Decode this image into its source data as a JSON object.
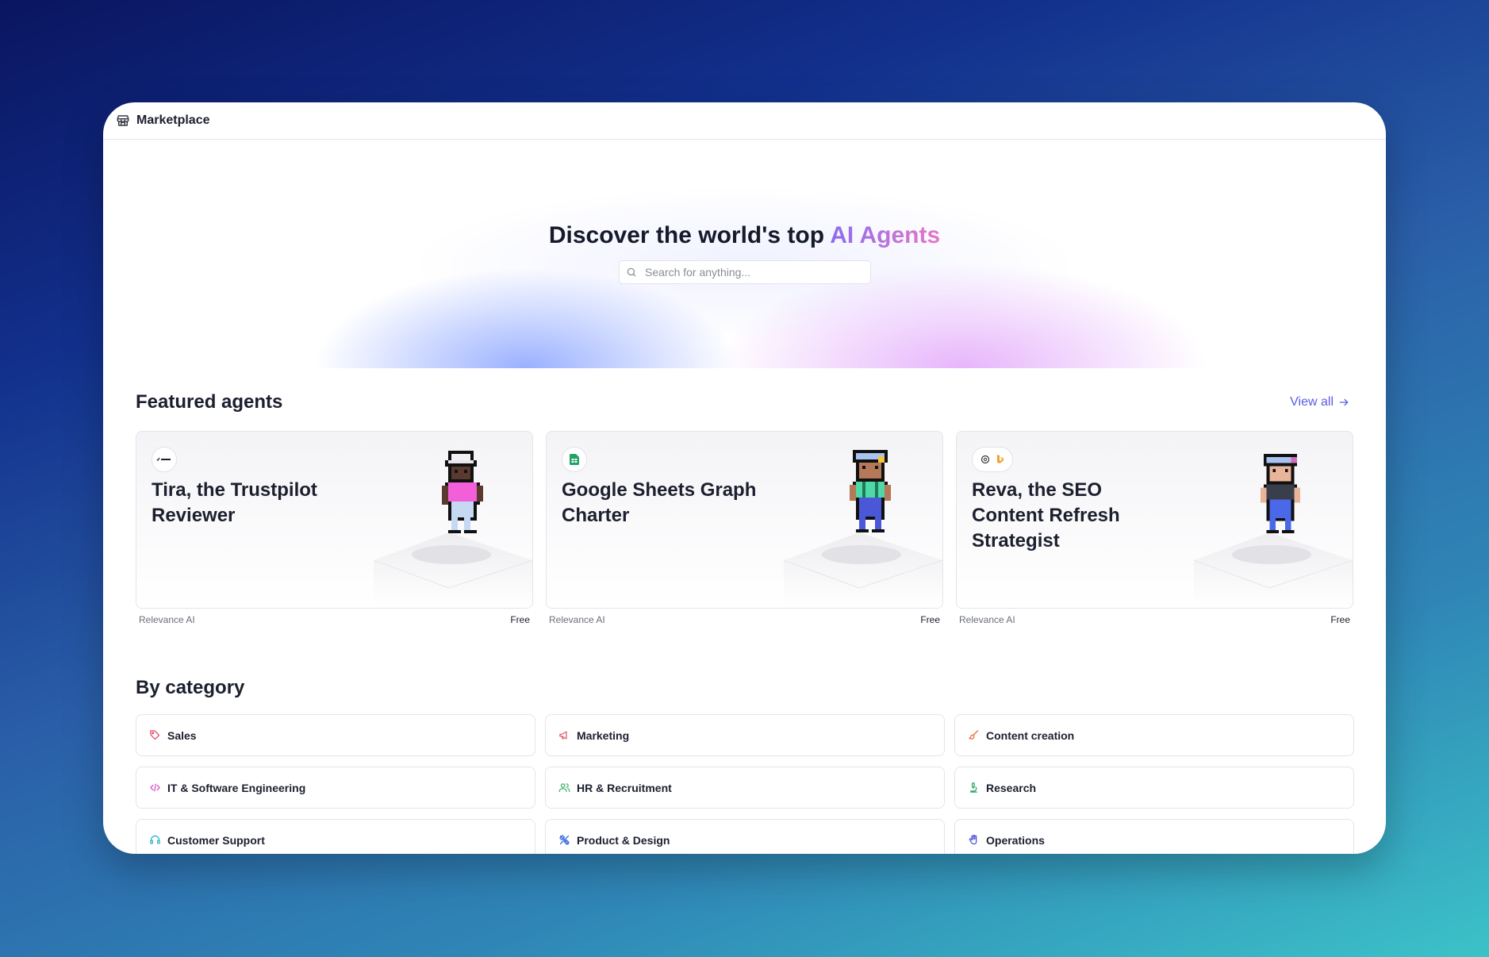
{
  "window": {
    "title": "Marketplace",
    "icon": "store-icon"
  },
  "hero": {
    "heading_prefix": "Discover the world's top ",
    "heading_accent": "AI Agents",
    "accent_gradient": [
      "#8b6cf0",
      "#e778c8"
    ],
    "search_placeholder": "Search for anything..."
  },
  "featured": {
    "heading": "Featured agents",
    "view_all": "View all",
    "cards": [
      {
        "title": "Tira, the Trustpilot Reviewer",
        "publisher": "Relevance AI",
        "price": "Free",
        "logo": "trustpilot-logo"
      },
      {
        "title": "Google Sheets Graph Charter",
        "publisher": "Relevance AI",
        "price": "Free",
        "logo": "google-sheets-icon"
      },
      {
        "title": "Reva, the SEO Content Refresh Strategist",
        "publisher": "Relevance AI",
        "price": "Free",
        "logo": "openai-and-bing-icons"
      }
    ]
  },
  "categories": {
    "heading": "By category",
    "items": [
      {
        "label": "Sales",
        "icon": "tags-icon",
        "color": "#e0566e"
      },
      {
        "label": "Marketing",
        "icon": "megaphone-icon",
        "color": "#e0566e"
      },
      {
        "label": "Content creation",
        "icon": "brush-icon",
        "color": "#e8703a"
      },
      {
        "label": "IT & Software Engineering",
        "icon": "code-icon",
        "color": "#d957c9"
      },
      {
        "label": "HR & Recruitment",
        "icon": "users-icon",
        "color": "#3fb26b"
      },
      {
        "label": "Research",
        "icon": "microscope-icon",
        "color": "#2aa866"
      },
      {
        "label": "Customer Support",
        "icon": "headset-icon",
        "color": "#2ab0c8"
      },
      {
        "label": "Product & Design",
        "icon": "pen-ruler-icon",
        "color": "#3a6be0"
      },
      {
        "label": "Operations",
        "icon": "hand-icon",
        "color": "#4a4fd8"
      }
    ]
  }
}
